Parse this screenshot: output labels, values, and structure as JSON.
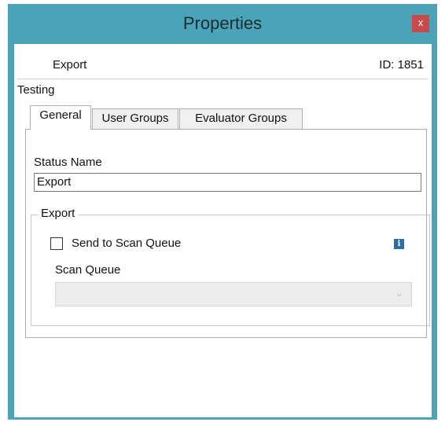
{
  "window": {
    "title": "Properties",
    "close_label": "x"
  },
  "header": {
    "status": "Export",
    "id_text": "ID: 1851"
  },
  "section_label": "Testing",
  "tabs": [
    {
      "label": "General",
      "active": true
    },
    {
      "label": "User Groups",
      "active": false
    },
    {
      "label": "Evaluator Groups",
      "active": false
    }
  ],
  "general": {
    "status_name_label": "Status Name",
    "status_name_value": "Export",
    "export_group": {
      "legend": "Export",
      "checkbox_label": "Send to Scan Queue",
      "checkbox_checked": false,
      "info_icon": "info-icon",
      "scan_queue_label": "Scan Queue",
      "scan_queue_value": "",
      "scan_queue_enabled": false
    }
  },
  "colors": {
    "frame": "#4aa3b6",
    "close": "#c94a4a",
    "info": "#2d6cab"
  }
}
